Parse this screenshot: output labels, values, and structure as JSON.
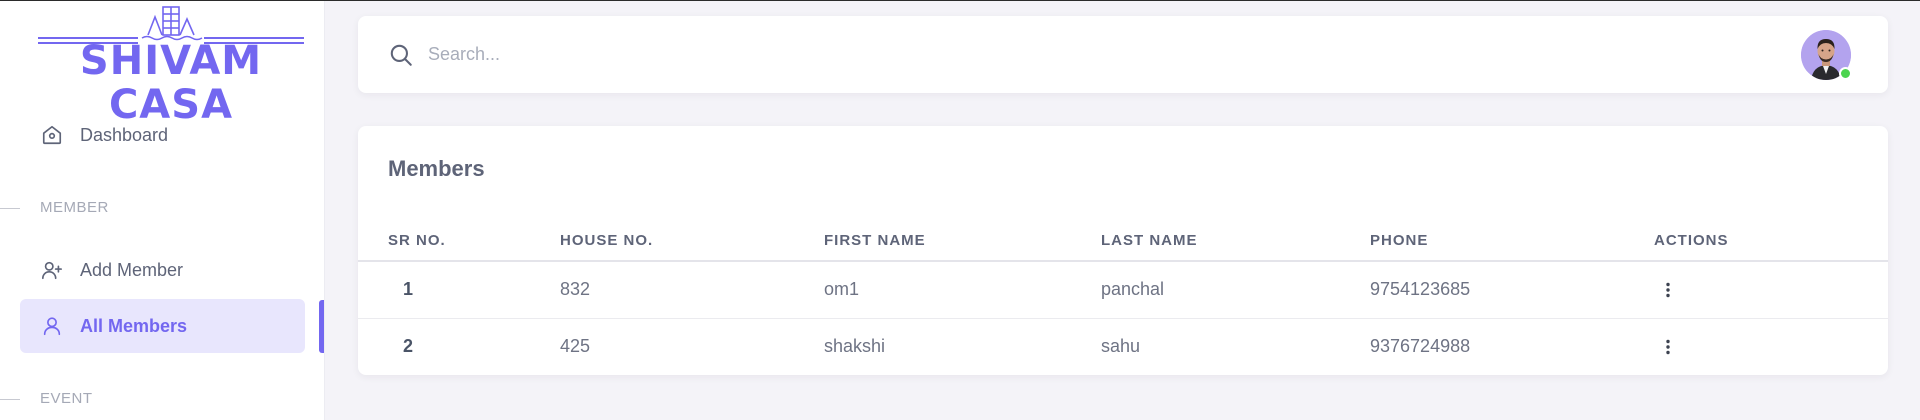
{
  "brand": {
    "name": "SHIVAM CASA",
    "accent": "#7367f0"
  },
  "sidebar": {
    "items": [
      {
        "label": "Dashboard",
        "icon": "home-icon"
      },
      {
        "label": "Add Member",
        "icon": "user-plus-icon"
      },
      {
        "label": "All Members",
        "icon": "user-icon",
        "active": true
      }
    ],
    "sections": {
      "member": "MEMBER",
      "event": "EVENT"
    }
  },
  "header": {
    "search_placeholder": "Search...",
    "search_value": "",
    "avatar_status_color": "#4cd44f"
  },
  "members": {
    "title": "Members",
    "columns": [
      "SR NO.",
      "HOUSE NO.",
      "FIRST NAME",
      "LAST NAME",
      "PHONE",
      "ACTIONS"
    ],
    "rows": [
      {
        "sr": "1",
        "house": "832",
        "first": "om1",
        "last": "panchal",
        "phone": "9754123685"
      },
      {
        "sr": "2",
        "house": "425",
        "first": "shakshi",
        "last": "sahu",
        "phone": "9376724988"
      }
    ]
  }
}
